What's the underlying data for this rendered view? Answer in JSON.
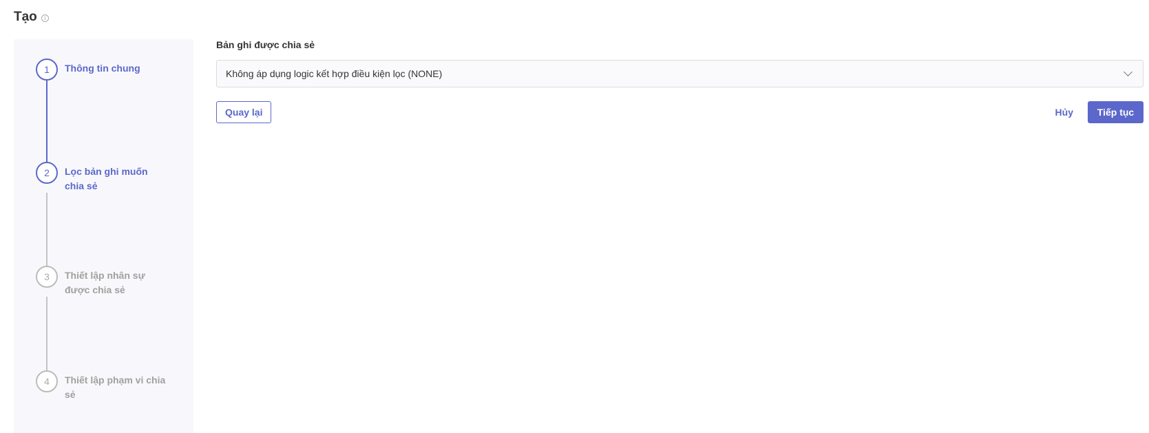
{
  "header": {
    "title": "Tạo",
    "info_icon": "info-icon"
  },
  "stepper": {
    "steps": [
      {
        "number": "1",
        "label": "Thông tin chung",
        "state": "active"
      },
      {
        "number": "2",
        "label": "Lọc bản ghi muốn chia sẻ",
        "state": "active"
      },
      {
        "number": "3",
        "label": "Thiết lập nhân sự được chia sẻ",
        "state": "inactive"
      },
      {
        "number": "4",
        "label": "Thiết lập phạm vi chia sẻ",
        "state": "inactive"
      }
    ]
  },
  "form": {
    "shared_records_label": "Bản ghi được chia sẻ",
    "shared_records_value": "Không áp dụng logic kết hợp điều kiện lọc (NONE)"
  },
  "actions": {
    "back_label": "Quay lại",
    "cancel_label": "Hủy",
    "next_label": "Tiếp tục"
  },
  "colors": {
    "accent": "#5b67ca",
    "inactive": "#a0a0a0",
    "sidebar_bg": "#f8f8fc"
  }
}
